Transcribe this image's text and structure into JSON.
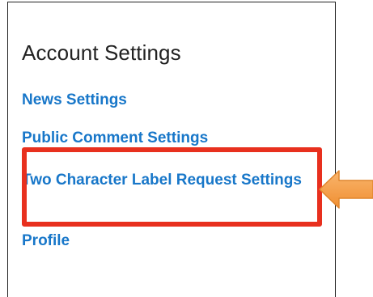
{
  "panel": {
    "title": "Account Settings",
    "links": [
      {
        "label": "News Settings"
      },
      {
        "label": "Public Comment Settings"
      },
      {
        "label": "Two Character Label Request Settings"
      },
      {
        "label": "Profile"
      }
    ]
  },
  "annotation": {
    "highlight_color": "#e8301e",
    "arrow_color": "#f6a04d",
    "arrow_direction": "left",
    "highlighted_link_index": 2
  },
  "colors": {
    "link": "#1877c9",
    "title": "#222222",
    "border": "#222222"
  }
}
